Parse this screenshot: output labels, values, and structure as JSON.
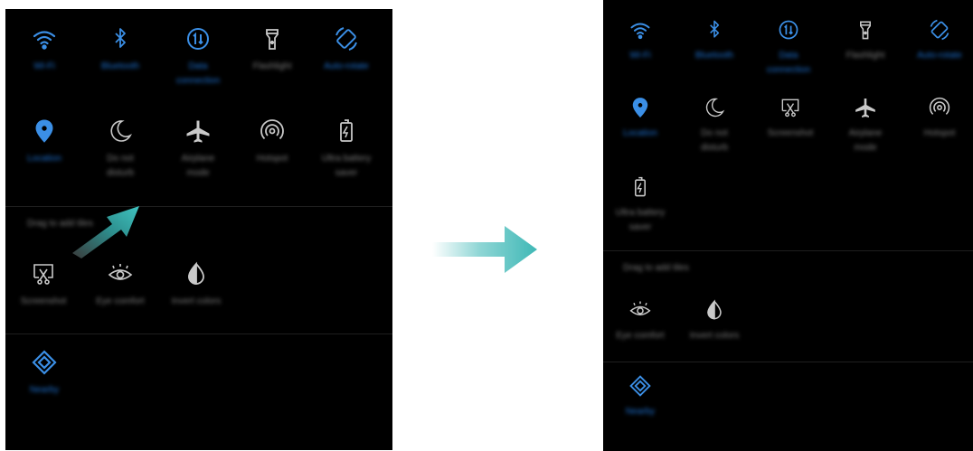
{
  "left_panel": {
    "active_tiles": [
      {
        "label": "Wi-Fi",
        "icon": "wifi-icon",
        "state": "on"
      },
      {
        "label": "Bluetooth",
        "icon": "bluetooth-icon",
        "state": "on"
      },
      {
        "label": "Data connection",
        "icon": "data-connection-icon",
        "state": "on"
      },
      {
        "label": "Flashlight",
        "icon": "flashlight-icon",
        "state": "off"
      },
      {
        "label": "Auto-rotate",
        "icon": "auto-rotate-icon",
        "state": "on"
      },
      {
        "label": "Location",
        "icon": "location-icon",
        "state": "on"
      },
      {
        "label": "Do not disturb",
        "icon": "moon-icon",
        "state": "off"
      },
      {
        "label": "Airplane mode",
        "icon": "airplane-icon",
        "state": "off"
      },
      {
        "label": "Hotspot",
        "icon": "hotspot-icon",
        "state": "off"
      },
      {
        "label": "Ultra battery saver",
        "icon": "battery-icon",
        "state": "off"
      }
    ],
    "drag_hint": "Drag to add tiles",
    "inactive_tiles": [
      {
        "label": "Screenshot",
        "icon": "screenshot-icon"
      },
      {
        "label": "Eye comfort",
        "icon": "eye-icon"
      },
      {
        "label": "Invert colors",
        "icon": "invert-colors-icon"
      }
    ],
    "bottom_tiles": [
      {
        "label": "Nearby",
        "icon": "nearby-icon",
        "state": "on"
      }
    ]
  },
  "right_panel": {
    "active_tiles": [
      {
        "label": "Wi-Fi",
        "icon": "wifi-icon",
        "state": "on"
      },
      {
        "label": "Bluetooth",
        "icon": "bluetooth-icon",
        "state": "on"
      },
      {
        "label": "Data connection",
        "icon": "data-connection-icon",
        "state": "on"
      },
      {
        "label": "Flashlight",
        "icon": "flashlight-icon",
        "state": "off"
      },
      {
        "label": "Auto-rotate",
        "icon": "auto-rotate-icon",
        "state": "on"
      },
      {
        "label": "Location",
        "icon": "location-icon",
        "state": "on"
      },
      {
        "label": "Do not disturb",
        "icon": "moon-icon",
        "state": "off"
      },
      {
        "label": "Screenshot",
        "icon": "screenshot-icon",
        "state": "off"
      },
      {
        "label": "Airplane mode",
        "icon": "airplane-icon",
        "state": "off"
      },
      {
        "label": "Hotspot",
        "icon": "hotspot-icon",
        "state": "off"
      },
      {
        "label": "Ultra battery saver",
        "icon": "battery-icon",
        "state": "off"
      }
    ],
    "drag_hint": "Drag to add tiles",
    "inactive_tiles": [
      {
        "label": "Eye comfort",
        "icon": "eye-icon"
      },
      {
        "label": "Invert colors",
        "icon": "invert-colors-icon"
      }
    ],
    "bottom_tiles": [
      {
        "label": "Nearby",
        "icon": "nearby-icon",
        "state": "on"
      }
    ]
  },
  "colors": {
    "accent": "#3b8fe6",
    "inactive_icon": "#c9c9c9",
    "panel_bg": "#000000",
    "arrow": "#3fb8b6"
  }
}
